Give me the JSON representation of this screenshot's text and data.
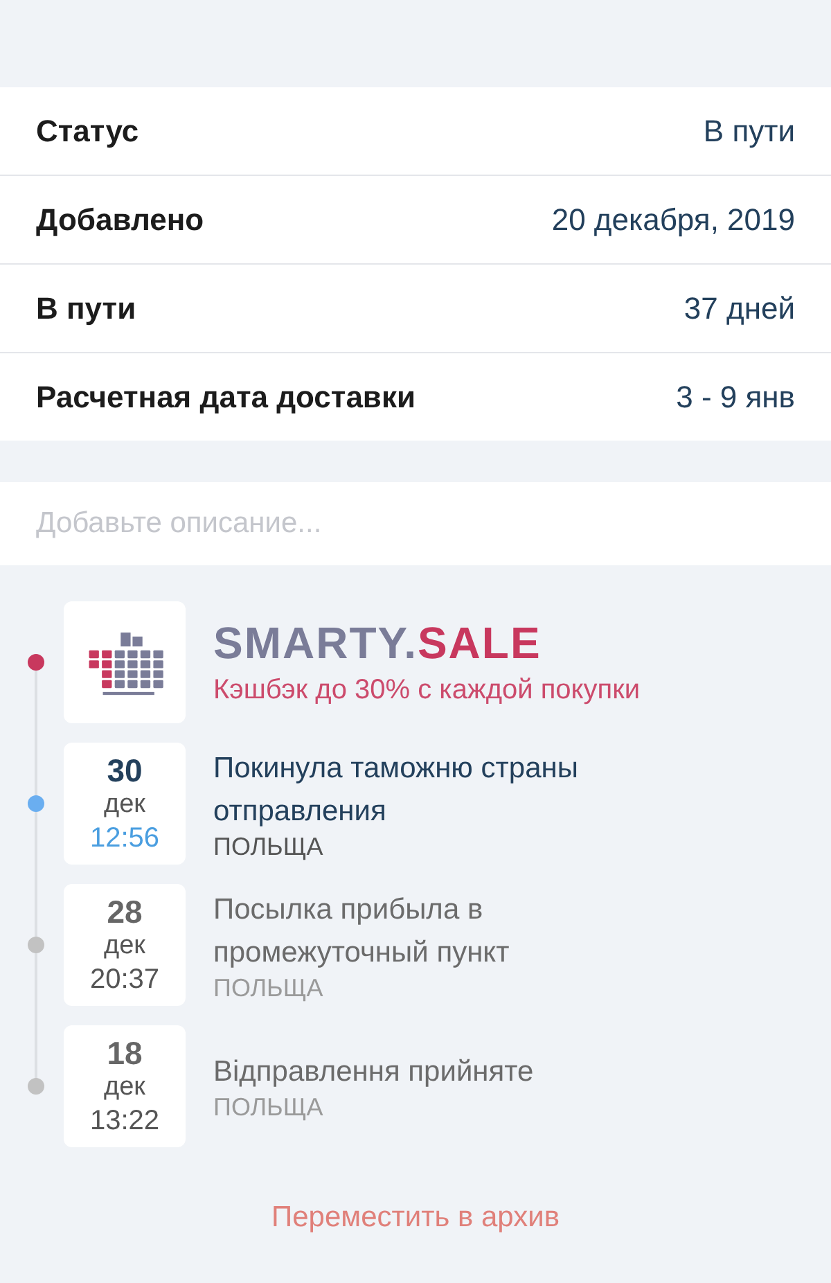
{
  "details": [
    {
      "label": "Статус",
      "value": "В пути"
    },
    {
      "label": "Добавлено",
      "value": "20 декабря, 2019"
    },
    {
      "label": "В пути",
      "value": "37 дней"
    },
    {
      "label": "Расчетная дата доставки",
      "value": "3 - 9 янв"
    }
  ],
  "description": {
    "placeholder": "Добавьте описание..."
  },
  "timeline": [
    {
      "kind": "ad",
      "color": "#c8385e",
      "brand": "SMARTY.",
      "brand_accent": "SALE",
      "tagline": "Кэшбэк до 30% с каждой покупки"
    },
    {
      "kind": "event",
      "current": true,
      "day": "30",
      "month": "дек",
      "time": "12:56",
      "title": "Покинула таможню страны отправления",
      "place": "ПОЛЬЩА"
    },
    {
      "kind": "event",
      "current": false,
      "day": "28",
      "month": "дек",
      "time": "20:37",
      "title": "Посылка прибыла в промежуточный пункт",
      "place": "ПОЛЬЩА"
    },
    {
      "kind": "event",
      "current": false,
      "day": "18",
      "month": "дек",
      "time": "13:22",
      "title": "Відправлення прийняте",
      "place": "ПОЛЬЩА"
    }
  ],
  "archive_button": "Переместить в архив"
}
